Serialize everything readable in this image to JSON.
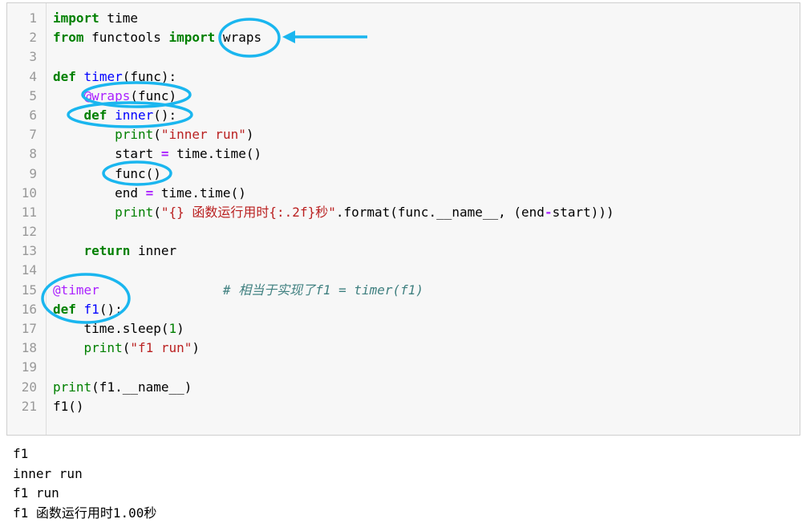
{
  "code_cell": {
    "lines": [
      {
        "n": "1",
        "tokens": [
          {
            "t": "import",
            "c": "kw"
          },
          {
            "t": " time",
            "c": ""
          }
        ]
      },
      {
        "n": "2",
        "tokens": [
          {
            "t": "from",
            "c": "kw"
          },
          {
            "t": " functools ",
            "c": ""
          },
          {
            "t": "import",
            "c": "kw"
          },
          {
            "t": " wraps",
            "c": ""
          }
        ]
      },
      {
        "n": "3",
        "tokens": []
      },
      {
        "n": "4",
        "tokens": [
          {
            "t": "def",
            "c": "kw"
          },
          {
            "t": " ",
            "c": ""
          },
          {
            "t": "timer",
            "c": "def"
          },
          {
            "t": "(func):",
            "c": ""
          }
        ]
      },
      {
        "n": "5",
        "tokens": [
          {
            "t": "    ",
            "c": ""
          },
          {
            "t": "@wraps",
            "c": "dec"
          },
          {
            "t": "(func)",
            "c": ""
          }
        ]
      },
      {
        "n": "6",
        "tokens": [
          {
            "t": "    ",
            "c": ""
          },
          {
            "t": "def",
            "c": "kw"
          },
          {
            "t": " ",
            "c": ""
          },
          {
            "t": "inner",
            "c": "def"
          },
          {
            "t": "():",
            "c": ""
          }
        ]
      },
      {
        "n": "7",
        "tokens": [
          {
            "t": "        ",
            "c": ""
          },
          {
            "t": "print",
            "c": "bi"
          },
          {
            "t": "(",
            "c": ""
          },
          {
            "t": "\"inner run\"",
            "c": "str"
          },
          {
            "t": ")",
            "c": ""
          }
        ]
      },
      {
        "n": "8",
        "tokens": [
          {
            "t": "        start ",
            "c": ""
          },
          {
            "t": "=",
            "c": "op"
          },
          {
            "t": " time.time()",
            "c": ""
          }
        ]
      },
      {
        "n": "9",
        "tokens": [
          {
            "t": "        func()",
            "c": ""
          }
        ]
      },
      {
        "n": "10",
        "tokens": [
          {
            "t": "        end ",
            "c": ""
          },
          {
            "t": "=",
            "c": "op"
          },
          {
            "t": " time.time()",
            "c": ""
          }
        ]
      },
      {
        "n": "11",
        "tokens": [
          {
            "t": "        ",
            "c": ""
          },
          {
            "t": "print",
            "c": "bi"
          },
          {
            "t": "(",
            "c": ""
          },
          {
            "t": "\"{} 函数运行用时{:.2f}秒\"",
            "c": "str"
          },
          {
            "t": ".format(func.__name__, (end",
            "c": ""
          },
          {
            "t": "-",
            "c": "op"
          },
          {
            "t": "start)))",
            "c": ""
          }
        ]
      },
      {
        "n": "12",
        "tokens": []
      },
      {
        "n": "13",
        "tokens": [
          {
            "t": "    ",
            "c": ""
          },
          {
            "t": "return",
            "c": "kw"
          },
          {
            "t": " inner",
            "c": ""
          }
        ]
      },
      {
        "n": "14",
        "tokens": []
      },
      {
        "n": "15",
        "tokens": [
          {
            "t": "@timer",
            "c": "dec"
          },
          {
            "t": "                ",
            "c": ""
          },
          {
            "t": "# 相当于实现了f1 = timer(f1)",
            "c": "cm"
          }
        ]
      },
      {
        "n": "16",
        "tokens": [
          {
            "t": "def",
            "c": "kw"
          },
          {
            "t": " ",
            "c": ""
          },
          {
            "t": "f1",
            "c": "def"
          },
          {
            "t": "():",
            "c": ""
          }
        ]
      },
      {
        "n": "17",
        "tokens": [
          {
            "t": "    time.sleep(",
            "c": ""
          },
          {
            "t": "1",
            "c": "num"
          },
          {
            "t": ")",
            "c": ""
          }
        ]
      },
      {
        "n": "18",
        "tokens": [
          {
            "t": "    ",
            "c": ""
          },
          {
            "t": "print",
            "c": "bi"
          },
          {
            "t": "(",
            "c": ""
          },
          {
            "t": "\"f1 run\"",
            "c": "str"
          },
          {
            "t": ")",
            "c": ""
          }
        ]
      },
      {
        "n": "19",
        "tokens": []
      },
      {
        "n": "20",
        "tokens": [
          {
            "t": "print",
            "c": "bi"
          },
          {
            "t": "(f1.__name__)",
            "c": ""
          }
        ]
      },
      {
        "n": "21",
        "tokens": [
          {
            "t": "f1()",
            "c": ""
          }
        ]
      }
    ]
  },
  "output": {
    "lines": [
      "f1",
      "inner run",
      "f1 run",
      "f1 函数运行用时1.00秒"
    ]
  },
  "colors": {
    "annotation": "#1ab6ef",
    "keyword": "#008000",
    "function_name": "#0000ff",
    "string": "#ba2121",
    "decorator": "#aa22ff",
    "comment": "#408080"
  }
}
